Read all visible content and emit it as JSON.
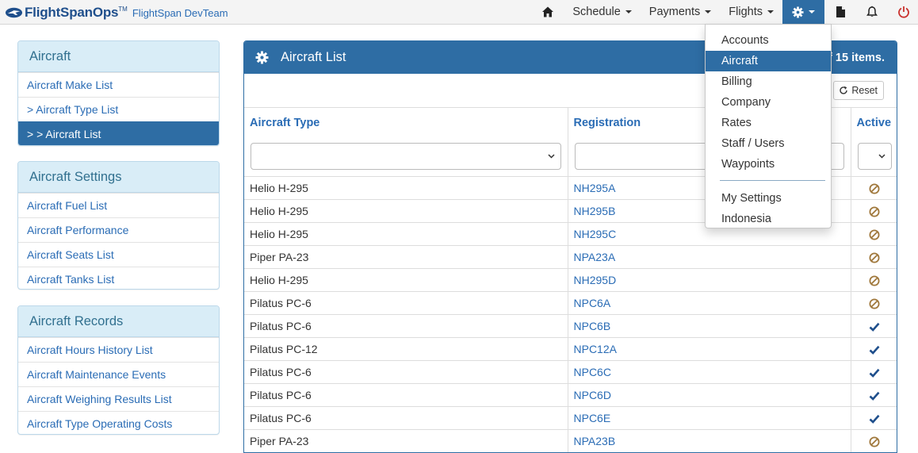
{
  "brand": {
    "name": "FlightSpanOps",
    "tm": "TM",
    "team": "FlightSpan DevTeam"
  },
  "nav": {
    "items": [
      {
        "label": "Schedule"
      },
      {
        "label": "Payments"
      },
      {
        "label": "Flights"
      }
    ],
    "icons": [
      "home-icon",
      "gear-icon",
      "document-icon",
      "bell-icon",
      "power-icon"
    ]
  },
  "sidebar": {
    "aircraft": {
      "heading": "Aircraft",
      "items": [
        "Aircraft Make List",
        "> Aircraft Type List",
        "> > Aircraft List"
      ],
      "selected_index": 2
    },
    "settings": {
      "heading": "Aircraft Settings",
      "items": [
        "Aircraft Fuel List",
        "Aircraft Performance",
        "Aircraft Seats List",
        "Aircraft Tanks List"
      ]
    },
    "records": {
      "heading": "Aircraft Records",
      "items": [
        "Aircraft Hours History List",
        "Aircraft Maintenance Events",
        "Aircraft Weighing Results List",
        "Aircraft Type Operating Costs"
      ]
    }
  },
  "main": {
    "title": "Aircraft List",
    "items_count_text": "f 15 items.",
    "reset_label": "Reset",
    "columns": {
      "type": "Aircraft Type",
      "registration": "Registration",
      "active": "Active"
    },
    "rows": [
      {
        "type": "Helio H-295",
        "registration": "NH295A",
        "active": false
      },
      {
        "type": "Helio H-295",
        "registration": "NH295B",
        "active": false
      },
      {
        "type": "Helio H-295",
        "registration": "NH295C",
        "active": false
      },
      {
        "type": "Piper PA-23",
        "registration": "NPA23A",
        "active": false
      },
      {
        "type": "Helio H-295",
        "registration": "NH295D",
        "active": false
      },
      {
        "type": "Pilatus PC-6",
        "registration": "NPC6A",
        "active": false
      },
      {
        "type": "Pilatus PC-6",
        "registration": "NPC6B",
        "active": true
      },
      {
        "type": "Pilatus PC-12",
        "registration": "NPC12A",
        "active": true
      },
      {
        "type": "Pilatus PC-6",
        "registration": "NPC6C",
        "active": true
      },
      {
        "type": "Pilatus PC-6",
        "registration": "NPC6D",
        "active": true
      },
      {
        "type": "Pilatus PC-6",
        "registration": "NPC6E",
        "active": true
      },
      {
        "type": "Piper PA-23",
        "registration": "NPA23B",
        "active": false
      }
    ]
  },
  "dropdown": {
    "items_top": [
      "Accounts",
      "Aircraft",
      "Billing",
      "Company",
      "Rates",
      "Staff / Users",
      "Waypoints"
    ],
    "items_bottom": [
      "My Settings",
      "Indonesia"
    ],
    "selected": "Aircraft"
  },
  "colors": {
    "primary": "#2e6da4",
    "link": "#2a6cb5",
    "panel_heading_bg": "#d9edf7",
    "inactive_icon": "#a0783c",
    "active_icon": "#1f4f8c"
  }
}
